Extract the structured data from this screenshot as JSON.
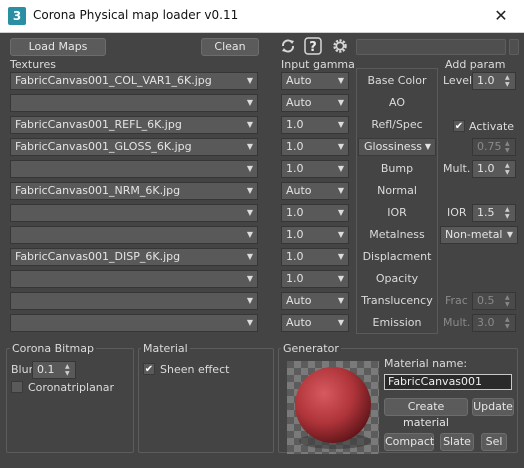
{
  "window": {
    "icon_label": "3",
    "title": "Corona Physical map loader v0.11",
    "close_glyph": "✕"
  },
  "toolbar": {
    "load_maps": "Load Maps",
    "clean": "Clean",
    "refresh_icon": "refresh-icon",
    "help_icon": "help-icon",
    "settings_icon": "gear-icon"
  },
  "textures": {
    "header": "Textures",
    "rows": [
      "FabricCanvas001_COL_VAR1_6K.jpg",
      "",
      "FabricCanvas001_REFL_6K.jpg",
      "FabricCanvas001_GLOSS_6K.jpg",
      "",
      "FabricCanvas001_NRM_6K.jpg",
      "",
      "",
      "FabricCanvas001_DISP_6K.jpg",
      "",
      "",
      ""
    ]
  },
  "gamma": {
    "header": "Input gamma",
    "rows": [
      "Auto",
      "Auto",
      "1.0",
      "1.0",
      "1.0",
      "Auto",
      "1.0",
      "1.0",
      "1.0",
      "1.0",
      "Auto",
      "Auto"
    ]
  },
  "slots": {
    "labels": [
      "Base Color",
      "AO",
      "Refl/Spec",
      "Glossiness",
      "Bump",
      "Normal",
      "IOR",
      "Metalness",
      "Displacment",
      "Opacity",
      "Translucency",
      "Emission"
    ]
  },
  "add_param": {
    "header": "Add param",
    "level_label": "Level",
    "level_value": "1.0",
    "activate_label": "Activate",
    "activate_checked": true,
    "gloss_value": "0.75",
    "mult_label": "Mult.",
    "mult_value": "1.0",
    "ior_label": "IOR",
    "ior_value": "1.5",
    "metal_value": "Non-metal",
    "frac_label": "Frac",
    "frac_value": "0.5",
    "emission_mult_label": "Mult.",
    "emission_mult_value": "3.0"
  },
  "corona_bitmap": {
    "header": "Corona Bitmap",
    "blur_label": "Blur",
    "blur_value": "0.1",
    "triplanar_label": "Coronatriplanar",
    "triplanar_checked": false
  },
  "material": {
    "header": "Material",
    "sheen_label": "Sheen effect",
    "sheen_checked": true
  },
  "generator": {
    "header": "Generator",
    "name_label": "Material name:",
    "name_value": "FabricCanvas001",
    "create_material": "Create material",
    "update": "Update",
    "compact": "Compact",
    "slate": "Slate",
    "sel": "Sel"
  },
  "colors": {
    "background": "#444444",
    "sphere": "#b0353b",
    "title_icon": "#2b8fa3"
  }
}
